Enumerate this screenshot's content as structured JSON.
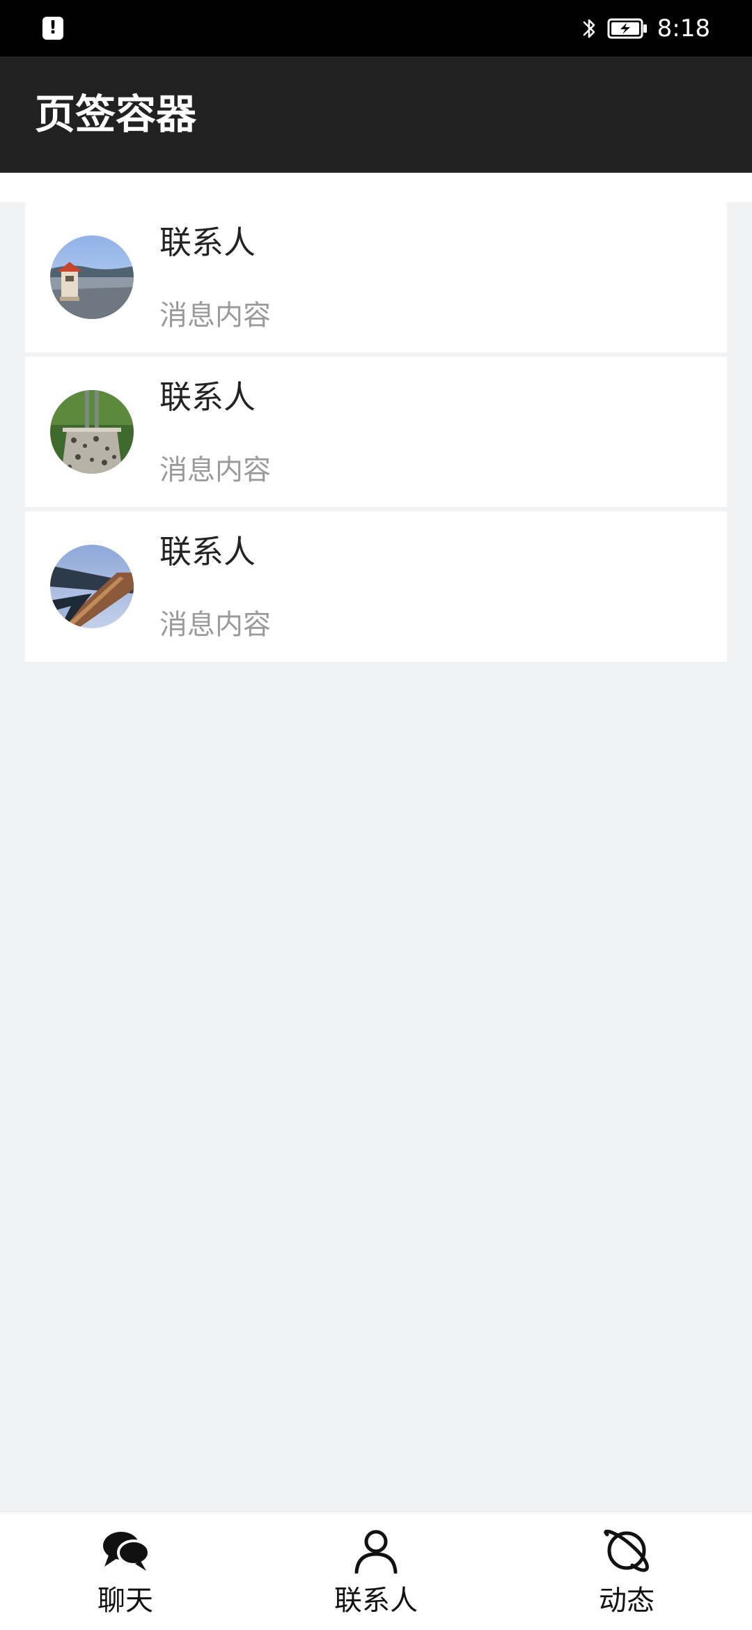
{
  "status_bar": {
    "time": "8:18",
    "alert_glyph": "!",
    "icons": [
      "alert-icon",
      "bluetooth-icon",
      "battery-charging-icon"
    ]
  },
  "app_bar": {
    "title": "页签容器"
  },
  "contacts": [
    {
      "name": "联系人",
      "message": "消息内容",
      "avatar": "pavilion-lake-avatar"
    },
    {
      "name": "联系人",
      "message": "消息内容",
      "avatar": "stone-vase-avatar"
    },
    {
      "name": "联系人",
      "message": "消息内容",
      "avatar": "bridge-water-avatar"
    }
  ],
  "bottom_nav": {
    "items": [
      {
        "label": "聊天",
        "icon": "chat-bubbles-icon"
      },
      {
        "label": "联系人",
        "icon": "person-icon"
      },
      {
        "label": "动态",
        "icon": "planet-icon"
      }
    ]
  },
  "colors": {
    "status_bar": "#000000",
    "app_bar": "#212121",
    "background": "#f1f2f4",
    "card": "#ffffff",
    "primary_text": "#222222",
    "secondary_text": "#9a9a9a"
  }
}
